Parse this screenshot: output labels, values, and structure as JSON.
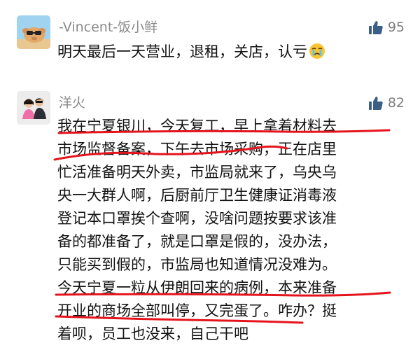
{
  "comments": [
    {
      "username": "-Vincent-饭小鲜",
      "likes": "95",
      "avatar_icon": "pig-with-sunglasses-avatar",
      "lines": [
        "明天最后一天营业，退租，关店，认亏"
      ],
      "trailing_emoji": "crying-face-emoji"
    },
    {
      "username": "洋火",
      "likes": "82",
      "avatar_icon": "couple-photo-avatar",
      "lines": [
        "我在宁夏银川，今天复工，早上拿着材料去",
        "市场监督备案，下午去市场采购，正在店里",
        "忙活准备明天外卖，市监局就来了，乌央乌",
        "央一大群人啊，后厨前厅卫生健康证消毒液",
        "登记本口罩挨个查啊，没啥问题按要求该准",
        "备的都准备了，就是口罩是假的，没办法，",
        "只能买到假的，市监局也知道情况没难为。",
        "今天宁夏一粒从伊朗回来的病例，本来准备",
        "开业的商场全部叫停，又完蛋了。咋办？挺",
        "着呗，员工也没来，自己干吧"
      ]
    }
  ],
  "colors": {
    "username": "#8a8a8a",
    "body_text": "#111111",
    "like_icon": "#3b5f86",
    "underline": "#e5141c"
  }
}
